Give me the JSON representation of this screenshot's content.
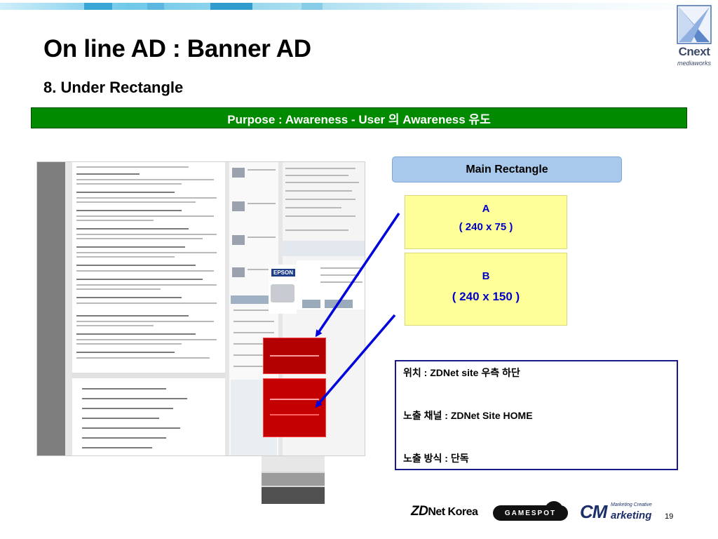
{
  "slide": {
    "title": "On line AD : Banner AD",
    "subtitle": "8.  Under Rectangle",
    "purpose": "Purpose : Awareness - User 의 Awareness 유도",
    "page_number": "19"
  },
  "logo": {
    "name": "Cnext",
    "tagline": "mediaworks"
  },
  "main_rectangle": {
    "label": "Main Rectangle"
  },
  "ad_slots": [
    {
      "letter": "A",
      "dimensions": "( 240 x 75 )"
    },
    {
      "letter": "B",
      "dimensions": "( 240 x 150 )"
    }
  ],
  "info": {
    "location": "위치 : ZDNet site 우측 하단",
    "channel": "노출 채널 : ZDNet Site HOME",
    "method": "노출 방식 : 단독"
  },
  "footer": {
    "zdnet_prefix": "ZD",
    "zdnet_suffix": "Net Korea",
    "gamespot": "GAMESPOT",
    "cm_letters": "CM",
    "cm_word": "arketing",
    "cm_tagline": "Marketing Creative"
  },
  "colors": {
    "purpose_bar": "#008a00",
    "main_rect_label_bg": "#a8c8ec",
    "ad_box_bg": "#ffff99",
    "ad_text": "#0000c8",
    "arrow": "#0000dd",
    "info_border": "#1a1a8c"
  }
}
